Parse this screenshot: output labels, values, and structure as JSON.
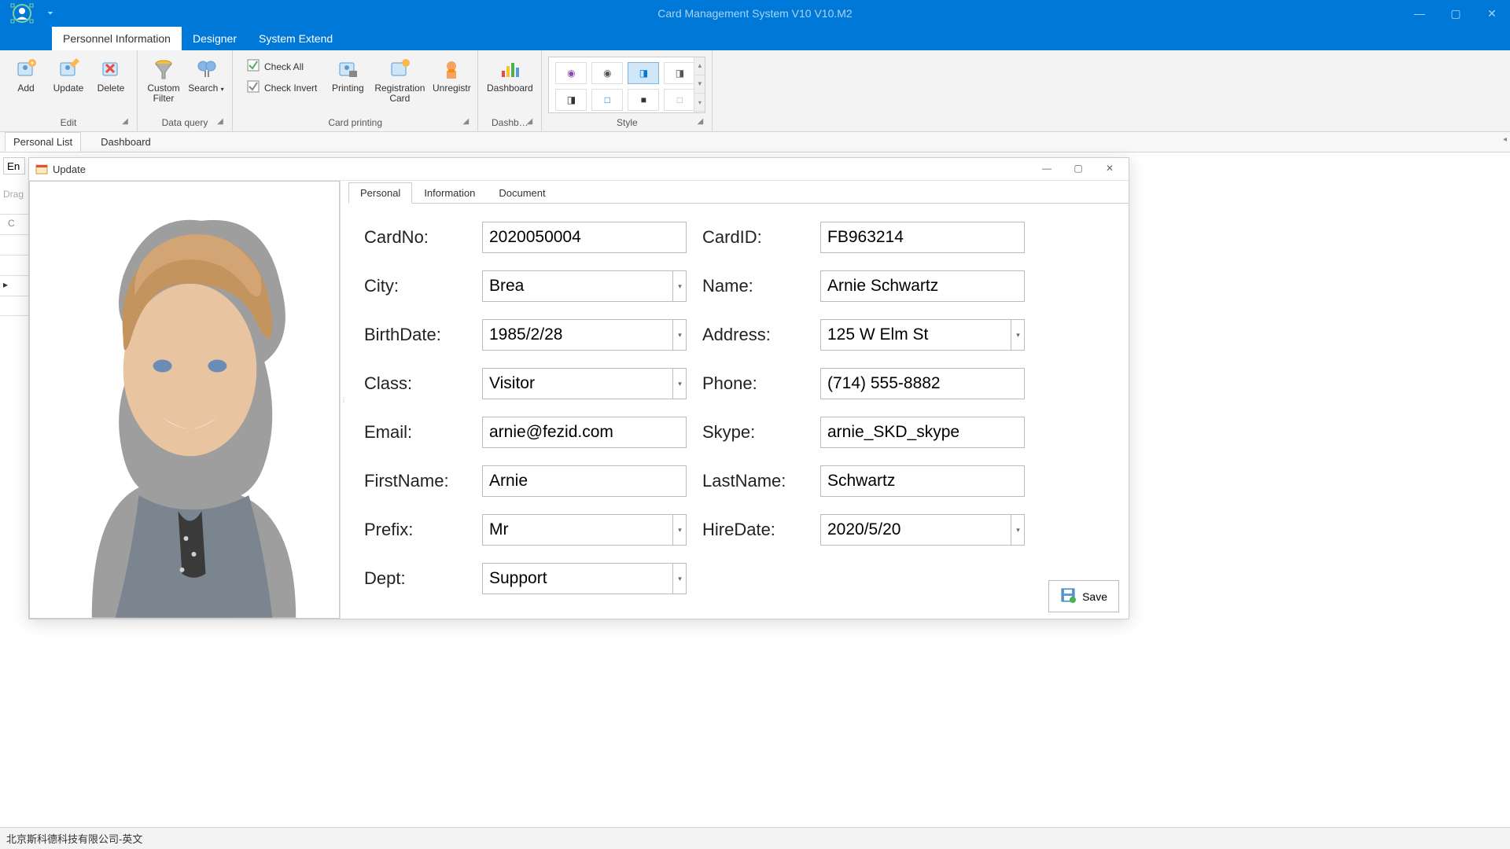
{
  "title": "Card Management System V10 V10.M2",
  "ribbon": {
    "tabs": [
      "Personnel Information",
      "Designer",
      "System Extend"
    ],
    "edit": {
      "label": "Edit",
      "add": "Add",
      "update": "Update",
      "delete": "Delete"
    },
    "dataquery": {
      "label": "Data query",
      "customFilter": "Custom\nFilter",
      "search": "Search"
    },
    "check": {
      "all": "Check All",
      "invert": "Check Invert"
    },
    "cardprinting": {
      "label": "Card printing",
      "printing": "Printing",
      "regcard": "Registration\nCard",
      "unregistr": "Unregistr"
    },
    "dashboard": {
      "label": "Dashb…",
      "btn": "Dashboard"
    },
    "style": {
      "label": "Style"
    }
  },
  "docTabs": {
    "personal": "Personal List",
    "dashboard": "Dashboard"
  },
  "leftInput": "En",
  "dragText": "Drag",
  "dialog": {
    "title": "Update",
    "tabs": [
      "Personal",
      "Information",
      "Document"
    ],
    "fields": {
      "cardNoL": "CardNo:",
      "cardNo": "2020050004",
      "cardIdL": "CardID:",
      "cardId": "FB963214",
      "cityL": "City:",
      "city": "Brea",
      "nameL": "Name:",
      "name": "Arnie Schwartz",
      "birthL": "BirthDate:",
      "birth": "1985/2/28",
      "addrL": "Address:",
      "addr": "125 W Elm St",
      "classL": "Class:",
      "class": "Visitor",
      "phoneL": "Phone:",
      "phone": "(714) 555-8882",
      "emailL": "Email:",
      "email": "arnie@fezid.com",
      "skypeL": "Skype:",
      "skype": "arnie_SKD_skype",
      "fnameL": "FirstName:",
      "fname": "Arnie",
      "lnameL": "LastName:",
      "lname": "Schwartz",
      "prefixL": "Prefix:",
      "prefix": "Mr",
      "hireL": "HireDate:",
      "hire": "2020/5/20",
      "deptL": "Dept:",
      "dept": "Support"
    },
    "save": "Save"
  },
  "status": "北京斯科德科技有限公司-英文"
}
